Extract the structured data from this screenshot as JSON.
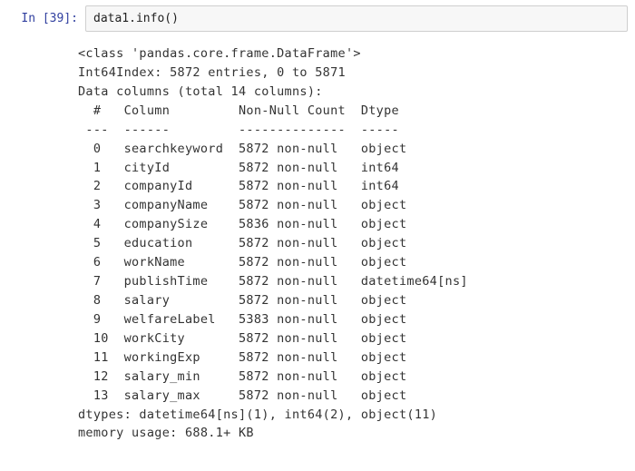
{
  "prompt": {
    "in_label": "In ",
    "exec_count": "[39]:"
  },
  "code": {
    "text": "data1.info()"
  },
  "output": {
    "class_line": "<class 'pandas.core.frame.DataFrame'>",
    "index_line": "Int64Index: 5872 entries, 0 to 5871",
    "columns_line": "Data columns (total 14 columns):",
    "header": {
      "num": " # ",
      "column": "Column",
      "nonnull": "Non-Null Count",
      "dtype": "Dtype"
    },
    "divider": {
      "num": "---",
      "column": "------",
      "nonnull": "--------------",
      "dtype": "-----"
    },
    "rows": [
      {
        "num": " 0 ",
        "column": "searchkeyword",
        "nonnull": "5872 non-null",
        "dtype": "object"
      },
      {
        "num": " 1 ",
        "column": "cityId",
        "nonnull": "5872 non-null",
        "dtype": "int64"
      },
      {
        "num": " 2 ",
        "column": "companyId",
        "nonnull": "5872 non-null",
        "dtype": "int64"
      },
      {
        "num": " 3 ",
        "column": "companyName",
        "nonnull": "5872 non-null",
        "dtype": "object"
      },
      {
        "num": " 4 ",
        "column": "companySize",
        "nonnull": "5836 non-null",
        "dtype": "object"
      },
      {
        "num": " 5 ",
        "column": "education",
        "nonnull": "5872 non-null",
        "dtype": "object"
      },
      {
        "num": " 6 ",
        "column": "workName",
        "nonnull": "5872 non-null",
        "dtype": "object"
      },
      {
        "num": " 7 ",
        "column": "publishTime",
        "nonnull": "5872 non-null",
        "dtype": "datetime64[ns]"
      },
      {
        "num": " 8 ",
        "column": "salary",
        "nonnull": "5872 non-null",
        "dtype": "object"
      },
      {
        "num": " 9 ",
        "column": "welfareLabel",
        "nonnull": "5383 non-null",
        "dtype": "object"
      },
      {
        "num": " 10",
        "column": "workCity",
        "nonnull": "5872 non-null",
        "dtype": "object"
      },
      {
        "num": " 11",
        "column": "workingExp",
        "nonnull": "5872 non-null",
        "dtype": "object"
      },
      {
        "num": " 12",
        "column": "salary_min",
        "nonnull": "5872 non-null",
        "dtype": "object"
      },
      {
        "num": " 13",
        "column": "salary_max",
        "nonnull": "5872 non-null",
        "dtype": "object"
      }
    ],
    "dtypes_line": "dtypes: datetime64[ns](1), int64(2), object(11)",
    "memory_line": "memory usage: 688.1+ KB"
  }
}
